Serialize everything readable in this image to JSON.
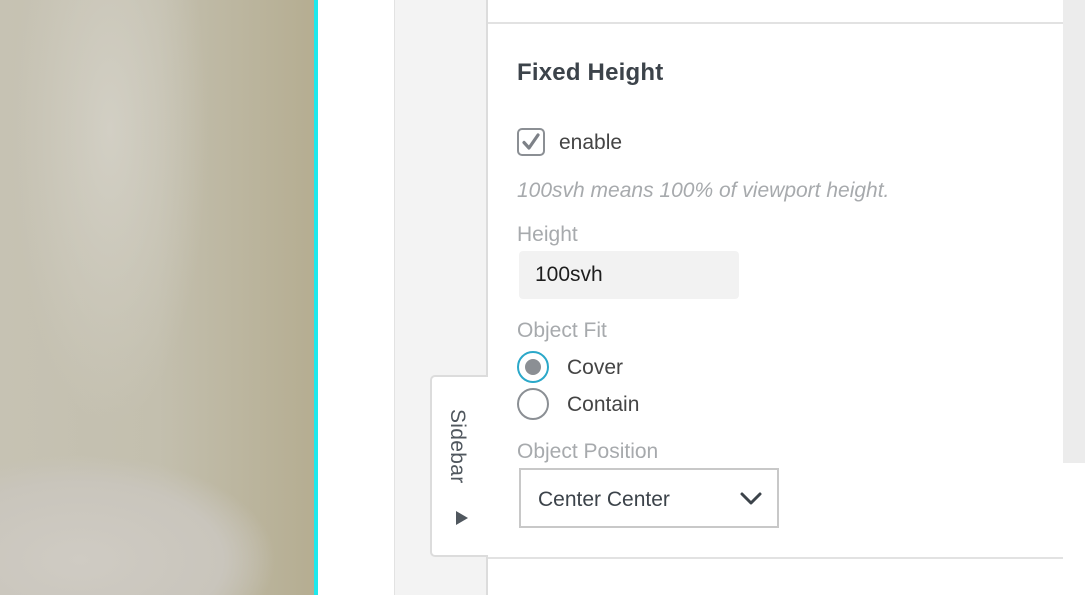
{
  "background": {
    "accent_color": "#1ee8ec"
  },
  "section": {
    "title": "Fixed Height",
    "enable_checkbox": {
      "label": "enable",
      "checked": true
    },
    "hint": "100svh means 100% of viewport height.",
    "height": {
      "label": "Height",
      "value": "100svh"
    },
    "object_fit": {
      "label": "Object Fit",
      "options": [
        {
          "label": "Cover",
          "selected": true
        },
        {
          "label": "Contain",
          "selected": false
        }
      ]
    },
    "object_position": {
      "label": "Object Position",
      "value": "Center Center"
    }
  },
  "sidebar_tab": {
    "label": "Sidebar",
    "icon": "triangle-right-icon"
  },
  "colors": {
    "radio_focus": "#2ba8c9",
    "text": "#3c434a",
    "muted": "#a7aaad"
  }
}
